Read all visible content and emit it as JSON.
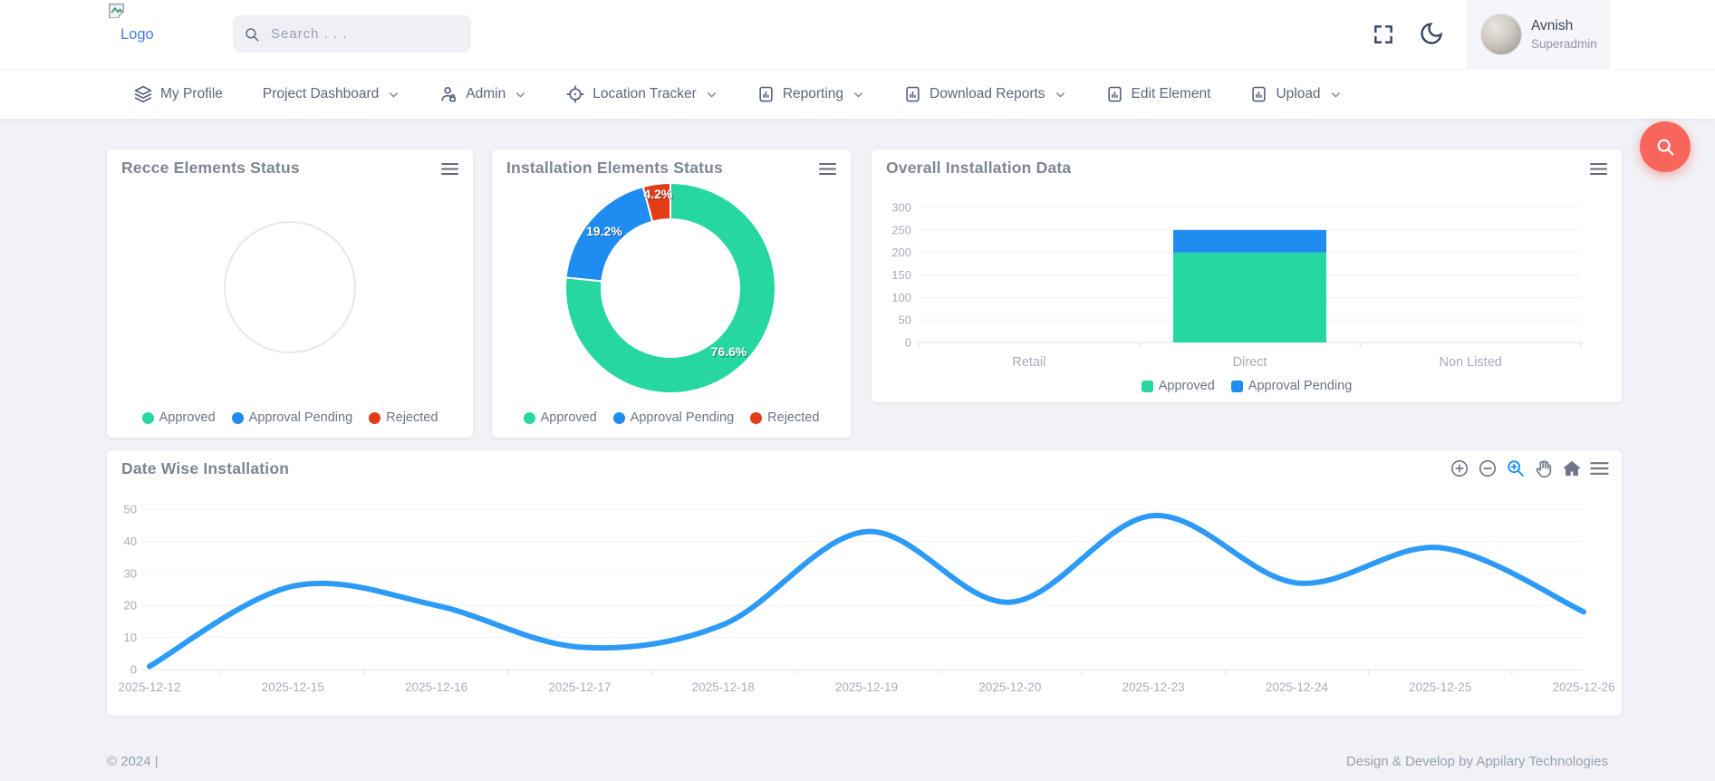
{
  "topbar": {
    "logo_text": "Logo",
    "search_placeholder": "Search . . .",
    "user_name": "Avnish",
    "user_role": "Superadmin"
  },
  "nav_items": [
    {
      "label": "My Profile",
      "icon": "layers-icon",
      "chevron": false
    },
    {
      "label": "Project Dashboard",
      "icon": "",
      "chevron": true
    },
    {
      "label": "Admin",
      "icon": "admin-user-icon",
      "chevron": true
    },
    {
      "label": "Location Tracker",
      "icon": "location-target-icon",
      "chevron": true
    },
    {
      "label": "Reporting",
      "icon": "report-icon",
      "chevron": true
    },
    {
      "label": "Download Reports",
      "icon": "report-icon",
      "chevron": true
    },
    {
      "label": "Edit Element",
      "icon": "report-icon",
      "chevron": false
    },
    {
      "label": "Upload",
      "icon": "report-icon",
      "chevron": true
    }
  ],
  "colors": {
    "approved": "#26d7a2",
    "approval_pending": "#1e8cf0",
    "rejected": "#e23b17",
    "line": "#2d9bf5",
    "fab": "#f8655a",
    "axis_label": "#a7adbb",
    "grid": "#f1f1f6",
    "axis_line": "#e2e3ea"
  },
  "chart_data": [
    {
      "id": "recce-donut",
      "type": "pie",
      "title": "Recce Elements Status",
      "labels": [
        "Approved",
        "Approval Pending",
        "Rejected"
      ],
      "values": [
        0,
        0,
        0
      ],
      "empty": true,
      "legend_position": "bottom"
    },
    {
      "id": "installation-donut",
      "type": "pie",
      "title": "Installation Elements Status",
      "labels": [
        "Approved",
        "Approval Pending",
        "Rejected"
      ],
      "values": [
        76.6,
        19.2,
        4.2
      ],
      "data_labels": [
        "76.6%",
        "19.2%",
        "4.2%"
      ],
      "empty": false,
      "legend_position": "bottom"
    },
    {
      "id": "overall-bar",
      "type": "bar",
      "title": "Overall Installation Data",
      "categories": [
        "Retail",
        "Direct",
        "Non Listed"
      ],
      "series": [
        {
          "name": "Approved",
          "values": [
            0,
            200,
            0
          ]
        },
        {
          "name": "Approval Pending",
          "values": [
            0,
            50,
            0
          ]
        }
      ],
      "stacked": true,
      "ylim": [
        0,
        300
      ],
      "yticks": [
        0,
        50,
        100,
        150,
        200,
        250,
        300
      ],
      "legend_position": "bottom"
    },
    {
      "id": "datewise-line",
      "type": "line",
      "title": "Date Wise Installation",
      "x": [
        "2025-12-12",
        "2025-12-15",
        "2025-12-16",
        "2025-12-17",
        "2025-12-18",
        "2025-12-19",
        "2025-12-20",
        "2025-12-23",
        "2025-12-24",
        "2025-12-25",
        "2025-12-26"
      ],
      "values": [
        1,
        26,
        20,
        7,
        14,
        43,
        21,
        48,
        27,
        38,
        18
      ],
      "ylim": [
        0,
        50
      ],
      "yticks": [
        0,
        10,
        20,
        30,
        40,
        50
      ],
      "toolbar": [
        "zoom-in-icon",
        "zoom-out-icon",
        "selection-zoom-icon",
        "pan-icon",
        "home-icon",
        "menu-icon"
      ],
      "toolbar_active": "selection-zoom-icon"
    }
  ],
  "footer": {
    "copyright": "© 2024 |",
    "credit": "Design & Develop by Appilary Technologies"
  }
}
